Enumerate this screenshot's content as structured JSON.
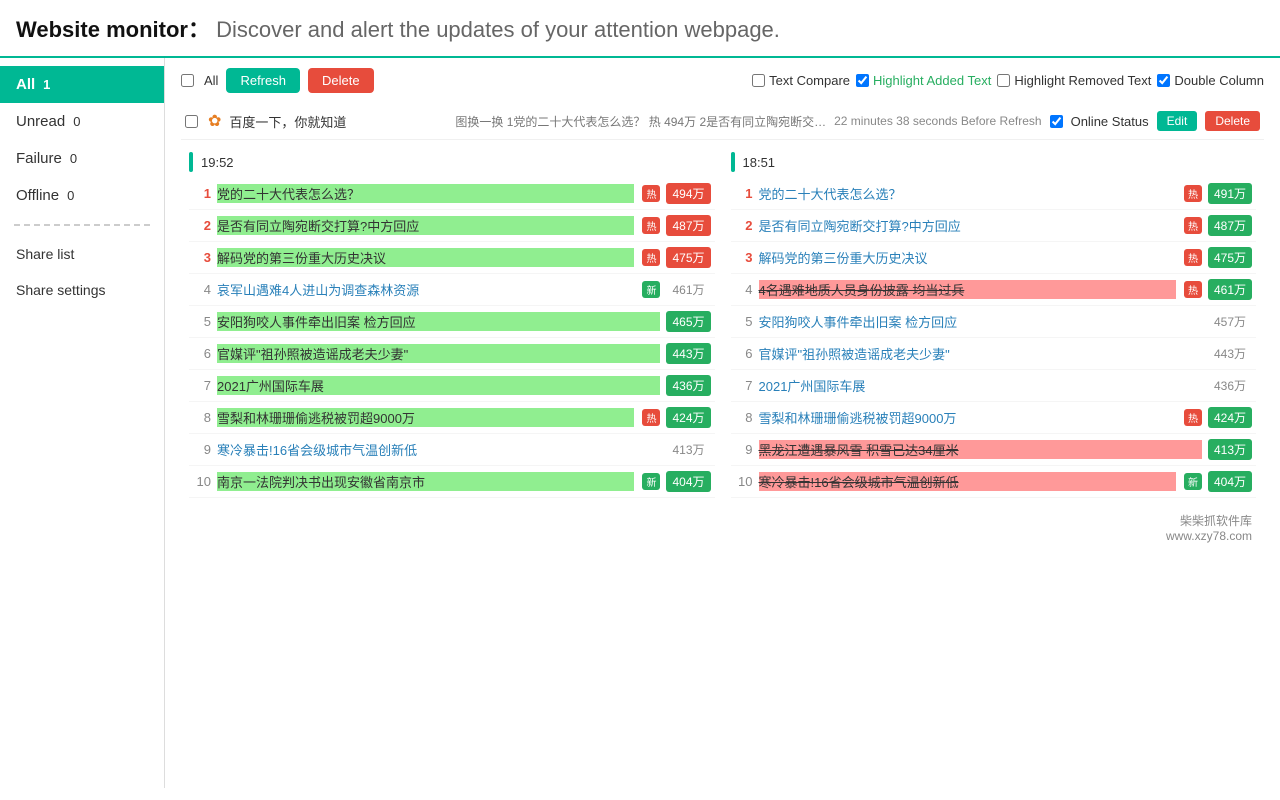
{
  "header": {
    "title": "Website monitor",
    "colon": "：",
    "subtitle": "Discover and alert the updates of your attention webpage."
  },
  "sidebar": {
    "items": [
      {
        "id": "all",
        "label": "All",
        "badge": "1",
        "active": true
      },
      {
        "id": "unread",
        "label": "Unread",
        "badge": "0",
        "active": false
      },
      {
        "id": "failure",
        "label": "Failure",
        "badge": "0",
        "active": false
      },
      {
        "id": "offline",
        "label": "Offline",
        "badge": "0",
        "active": false
      }
    ],
    "links": [
      {
        "id": "share-list",
        "label": "Share list"
      },
      {
        "id": "share-settings",
        "label": "Share settings"
      }
    ]
  },
  "toolbar": {
    "all_label": "All",
    "refresh_label": "Refresh",
    "delete_label": "Delete",
    "text_compare_label": "Text Compare",
    "highlight_added_label": "Highlight Added Text",
    "highlight_removed_label": "Highlight Removed Text",
    "double_column_label": "Double Column"
  },
  "site": {
    "name": "百度一下，你就知道",
    "preview": "图换一换 1党的二十大代表怎么选？ 热 494万 2是否有同立陶宛断交…",
    "meta": "22 minutes 38 seconds Before Refresh",
    "online_status_label": "Online Status",
    "edit_label": "Edit",
    "delete_label": "Delete"
  },
  "snapshot1": {
    "time": "19:52",
    "items": [
      {
        "rank": 1,
        "title": "党的二十大代表怎么选？",
        "hot": true,
        "new": false,
        "count": "494万",
        "highlight": "added"
      },
      {
        "rank": 2,
        "title": "是否有同立陶宛断交打算?中方回应",
        "hot": true,
        "new": false,
        "count": "487万",
        "highlight": "added"
      },
      {
        "rank": 3,
        "title": "解码党的第三份重大历史决议",
        "hot": true,
        "new": false,
        "count": "475万",
        "highlight": "added"
      },
      {
        "rank": 4,
        "title": "哀军山遇难4人进山为调查森林资源",
        "hot": false,
        "new": true,
        "count": "461万",
        "highlight": "none"
      },
      {
        "rank": 5,
        "title": "安阳狗咬人事件牵出旧案 检方回应",
        "hot": false,
        "new": false,
        "count": "465万",
        "highlight": "added"
      },
      {
        "rank": 6,
        "title": "官媒评\"祖孙照被造谣成老夫少妻\"",
        "hot": false,
        "new": false,
        "count": "443万",
        "highlight": "added"
      },
      {
        "rank": 7,
        "title": "2021广州国际车展",
        "hot": false,
        "new": false,
        "count": "436万",
        "highlight": "added"
      },
      {
        "rank": 8,
        "title": "雪梨和林珊珊偷逃税被罚超9000万",
        "hot": true,
        "new": false,
        "count": "424万",
        "highlight": "added"
      },
      {
        "rank": 9,
        "title": "寒冷暴击!16省会级城市气温创新低",
        "hot": false,
        "new": false,
        "count": "413万",
        "highlight": "none"
      },
      {
        "rank": 10,
        "title": "南京一法院判决书出现安徽省南京市",
        "hot": false,
        "new": true,
        "count": "404万",
        "highlight": "added"
      }
    ]
  },
  "snapshot2": {
    "time": "18:51",
    "items": [
      {
        "rank": 1,
        "title": "党的二十大代表怎么选？",
        "hot": true,
        "new": false,
        "count": "491万",
        "highlight": "none"
      },
      {
        "rank": 2,
        "title": "是否有同立陶宛断交打算?中方回应",
        "hot": true,
        "new": false,
        "count": "487万",
        "highlight": "none"
      },
      {
        "rank": 3,
        "title": "解码党的第三份重大历史决议",
        "hot": true,
        "new": false,
        "count": "475万",
        "highlight": "none"
      },
      {
        "rank": 4,
        "title": "4名遇难地质人员身份披露 均当过兵",
        "hot": true,
        "new": false,
        "count": "461万",
        "highlight": "removed"
      },
      {
        "rank": 5,
        "title": "安阳狗咬人事件牵出旧案 检方回应",
        "hot": false,
        "new": false,
        "count": "457万",
        "highlight": "none"
      },
      {
        "rank": 6,
        "title": "官媒评\"祖孙照被造谣成老夫少妻\"",
        "hot": false,
        "new": false,
        "count": "443万",
        "highlight": "none"
      },
      {
        "rank": 7,
        "title": "2021广州国际车展",
        "hot": false,
        "new": false,
        "count": "436万",
        "highlight": "none"
      },
      {
        "rank": 8,
        "title": "雪梨和林珊珊偷逃税被罚超9000万",
        "hot": true,
        "new": false,
        "count": "424万",
        "highlight": "none"
      },
      {
        "rank": 9,
        "title": "黑龙江遭遇暴风雪 积雪已达34厘米",
        "hot": false,
        "new": false,
        "count": "413万",
        "highlight": "removed"
      },
      {
        "rank": 10,
        "title": "寒冷暴击!16省会级城市气温创新低",
        "hot": false,
        "new": true,
        "count": "404万",
        "highlight": "removed"
      }
    ]
  },
  "brand": "柴柴抓软件库\nwww.xzy78.com"
}
